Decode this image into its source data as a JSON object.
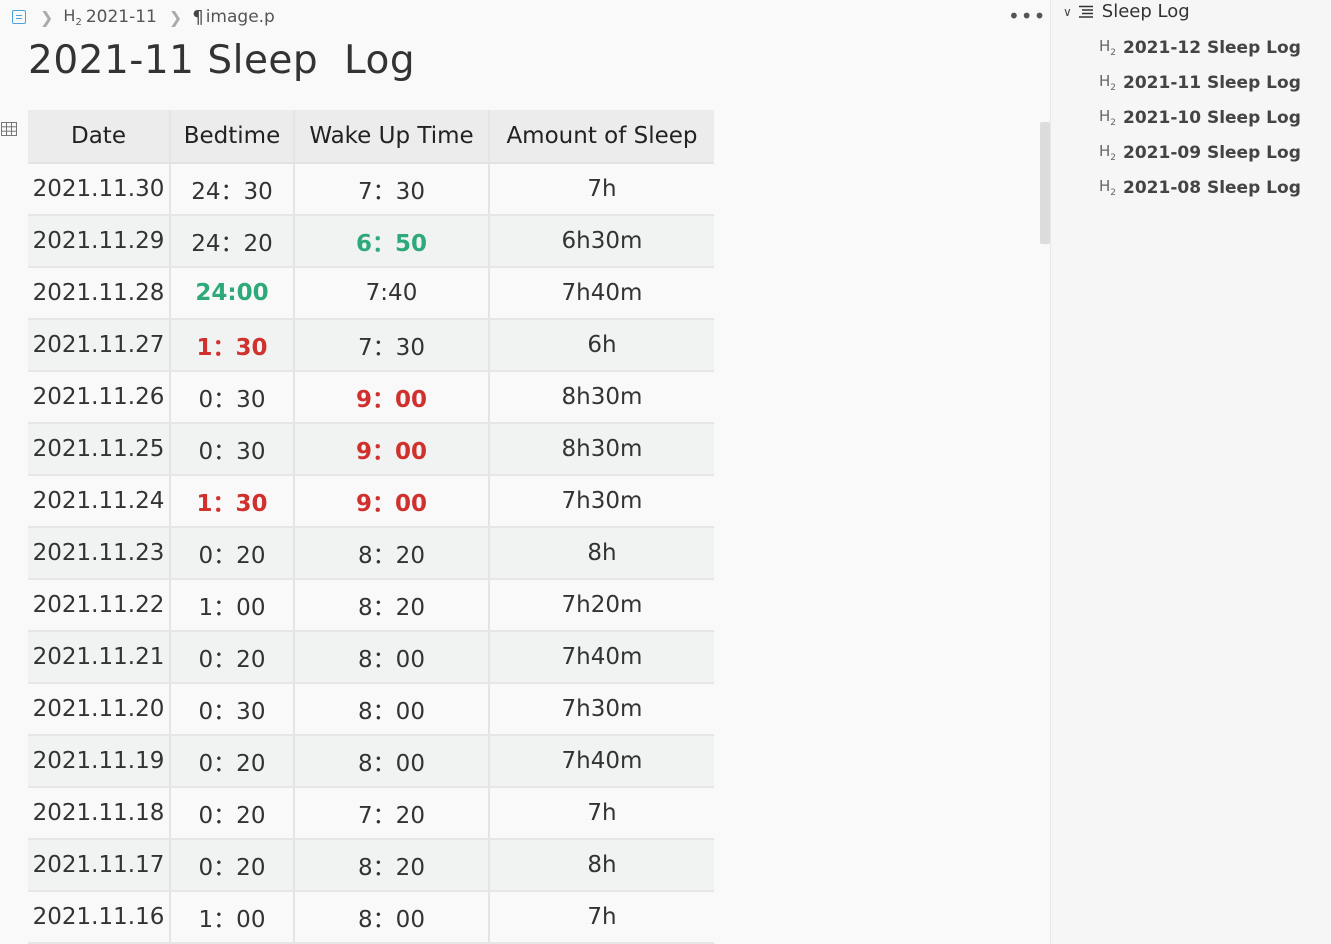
{
  "breadcrumb": {
    "heading_tag": "H2",
    "heading": "2021-11",
    "node": "image.p"
  },
  "page": {
    "title": "2021-11 Sleep  Log"
  },
  "table": {
    "headers": [
      "Date",
      "Bedtime",
      "Wake Up Time",
      "Amount of Sleep"
    ],
    "rows": [
      {
        "date": "2021.11.30",
        "bed": "24：30",
        "wake": "7：30",
        "amount": "7h",
        "bed_style": "",
        "wake_style": ""
      },
      {
        "date": "2021.11.29",
        "bed": "24：20",
        "wake": "6：50",
        "amount": "6h30m",
        "bed_style": "",
        "wake_style": "green"
      },
      {
        "date": "2021.11.28",
        "bed": "24:00",
        "wake": "7:40",
        "amount": "7h40m",
        "bed_style": "green",
        "wake_style": ""
      },
      {
        "date": "2021.11.27",
        "bed": "1：30",
        "wake": "7：30",
        "amount": "6h",
        "bed_style": "red",
        "wake_style": ""
      },
      {
        "date": "2021.11.26",
        "bed": "0：30",
        "wake": "9：00",
        "amount": "8h30m",
        "bed_style": "",
        "wake_style": "red"
      },
      {
        "date": "2021.11.25",
        "bed": "0：30",
        "wake": "9：00",
        "amount": "8h30m",
        "bed_style": "",
        "wake_style": "red"
      },
      {
        "date": "2021.11.24",
        "bed": "1：30",
        "wake": "9：00",
        "amount": "7h30m",
        "bed_style": "red",
        "wake_style": "red"
      },
      {
        "date": "2021.11.23",
        "bed": "0：20",
        "wake": "8：20",
        "amount": "8h",
        "bed_style": "",
        "wake_style": ""
      },
      {
        "date": "2021.11.22",
        "bed": "1：00",
        "wake": "8：20",
        "amount": "7h20m",
        "bed_style": "",
        "wake_style": ""
      },
      {
        "date": "2021.11.21",
        "bed": "0：20",
        "wake": "8：00",
        "amount": "7h40m",
        "bed_style": "",
        "wake_style": ""
      },
      {
        "date": "2021.11.20",
        "bed": "0：30",
        "wake": "8：00",
        "amount": "7h30m",
        "bed_style": "",
        "wake_style": ""
      },
      {
        "date": "2021.11.19",
        "bed": "0：20",
        "wake": "8：00",
        "amount": "7h40m",
        "bed_style": "",
        "wake_style": ""
      },
      {
        "date": "2021.11.18",
        "bed": "0：20",
        "wake": "7：20",
        "amount": "7h",
        "bed_style": "",
        "wake_style": ""
      },
      {
        "date": "2021.11.17",
        "bed": "0：20",
        "wake": "8：20",
        "amount": "8h",
        "bed_style": "",
        "wake_style": ""
      },
      {
        "date": "2021.11.16",
        "bed": "1：00",
        "wake": "8：00",
        "amount": "7h",
        "bed_style": "",
        "wake_style": ""
      }
    ]
  },
  "outline": {
    "root": "Sleep Log",
    "heading_tag": "H2",
    "items": [
      {
        "label": "2021-12 Sleep Log"
      },
      {
        "label": "2021-11 Sleep Log"
      },
      {
        "label": "2021-10 Sleep Log"
      },
      {
        "label": "2021-09 Sleep Log"
      },
      {
        "label": "2021-08 Sleep Log"
      }
    ]
  },
  "icons": {
    "doc": "doc-icon",
    "chevron": "chevron-right-icon",
    "paragraph": "paragraph-icon",
    "more": "more-icon",
    "table": "table-icon",
    "outline_list": "outline-list-icon"
  },
  "colors": {
    "early_wake": "#2ea97a",
    "late": "#d0312d",
    "accent": "#4aa3df"
  }
}
